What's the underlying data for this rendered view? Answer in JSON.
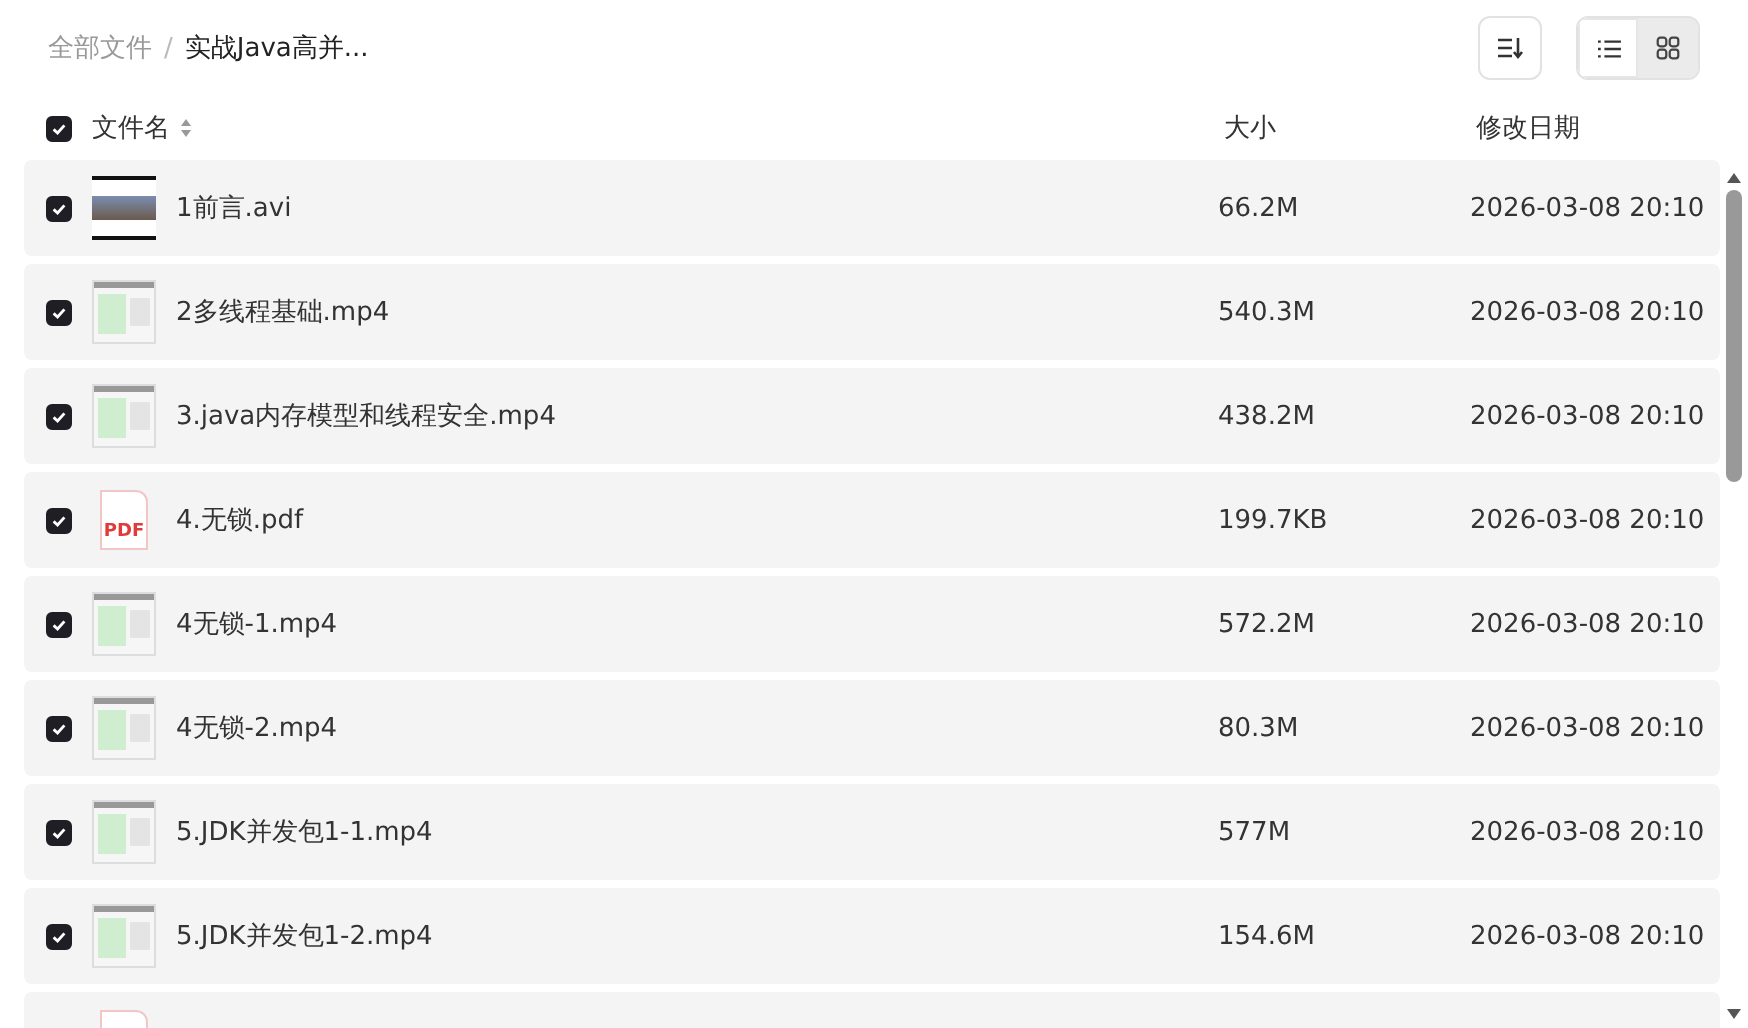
{
  "breadcrumb": [
    {
      "label": "全部文件",
      "current": false
    },
    {
      "label": "实战Java高并...",
      "current": true
    }
  ],
  "separator": "/",
  "view_modes": [
    {
      "kind": "list",
      "selected": true
    },
    {
      "kind": "grid",
      "selected": false
    }
  ],
  "columns": {
    "select_all": true,
    "name": "文件名",
    "size": "大小",
    "modified": "修改日期"
  },
  "rows": [
    {
      "kind": "photo",
      "checked": true,
      "name": "1前言.avi",
      "size": "66.2M",
      "modified": "2026-03-08 20:10"
    },
    {
      "kind": "screen",
      "checked": true,
      "name": "2多线程基础.mp4",
      "size": "540.3M",
      "modified": "2026-03-08 20:10"
    },
    {
      "kind": "screen",
      "checked": true,
      "name": "3.java内存模型和线程安全.mp4",
      "size": "438.2M",
      "modified": "2026-03-08 20:10"
    },
    {
      "kind": "pdf",
      "checked": true,
      "icon_text": "PDF",
      "name": "4.无锁.pdf",
      "size": "199.7KB",
      "modified": "2026-03-08 20:10"
    },
    {
      "kind": "screen",
      "checked": true,
      "name": "4无锁-1.mp4",
      "size": "572.2M",
      "modified": "2026-03-08 20:10"
    },
    {
      "kind": "screen",
      "checked": true,
      "name": "4无锁-2.mp4",
      "size": "80.3M",
      "modified": "2026-03-08 20:10"
    },
    {
      "kind": "screen",
      "checked": true,
      "name": "5.JDK并发包1-1.mp4",
      "size": "577M",
      "modified": "2026-03-08 20:10"
    },
    {
      "kind": "screen",
      "checked": true,
      "name": "5.JDK并发包1-2.mp4",
      "size": "154.6M",
      "modified": "2026-03-08 20:10"
    },
    {
      "kind": "pdf"
    }
  ]
}
